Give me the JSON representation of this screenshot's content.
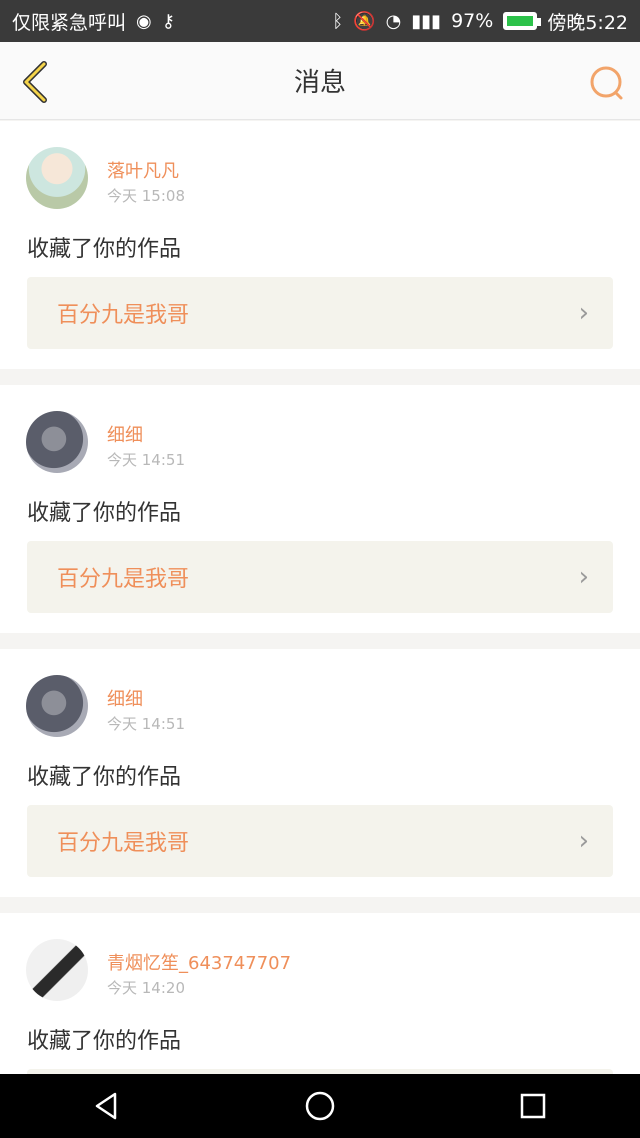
{
  "status_bar": {
    "left_text": "仅限紧急呼叫",
    "battery": "97%",
    "time": "傍晚5:22"
  },
  "header": {
    "title": "消息"
  },
  "messages": [
    {
      "user": "落叶凡凡",
      "time": "今天 15:08",
      "action": "收藏了你的作品",
      "work_title": "百分九是我哥"
    },
    {
      "user": "细细",
      "time": "今天 14:51",
      "action": "收藏了你的作品",
      "work_title": "百分九是我哥"
    },
    {
      "user": "细细",
      "time": "今天 14:51",
      "action": "收藏了你的作品",
      "work_title": "百分九是我哥"
    },
    {
      "user": "青烟忆笙_643747707",
      "time": "今天 14:20",
      "action": "收藏了你的作品",
      "work_title": ""
    }
  ]
}
